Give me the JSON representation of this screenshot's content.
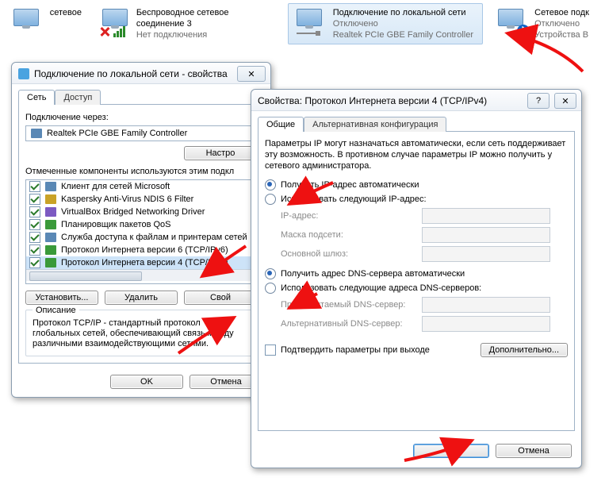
{
  "netbar": {
    "items": [
      {
        "title_suffix": "сетевое",
        "sub": ""
      },
      {
        "title": "Беспроводное сетевое соединение 3",
        "sub": "Нет подключения"
      },
      {
        "title": "Подключение по локальной сети",
        "sub1": "Отключено",
        "sub2": "Realtek PCIe GBE Family Controller"
      },
      {
        "title": "Сетевое подк",
        "sub1": "Отключено",
        "sub2": "Устройства B"
      }
    ]
  },
  "propsWin": {
    "title": "Подключение по локальной сети - свойства",
    "close": "✕",
    "tabs": {
      "net": "Сеть",
      "access": "Доступ"
    },
    "connect_via": "Подключение через:",
    "adapter": "Realtek PCIe GBE Family Controller",
    "configure": "Настро",
    "components_label": "Отмеченные компоненты используются этим подкл",
    "items": [
      "Клиент для сетей Microsoft",
      "Kaspersky Anti-Virus NDIS 6 Filter",
      "VirtualBox Bridged Networking Driver",
      "Планировщик пакетов QoS",
      "Служба доступа к файлам и принтерам сетей",
      "Протокол Интернета версии 6 (TCP/IPv6)",
      "Протокол Интернета версии 4 (TCP/IPv4)"
    ],
    "install": "Установить...",
    "remove": "Удалить",
    "props": "Свой",
    "desc_title": "Описание",
    "desc": "Протокол TCP/IP - стандартный протокол глобальных сетей, обеспечивающий связь между различными взаимодействующими сетями.",
    "ok": "OK",
    "cancel": "Отмена"
  },
  "ipWin": {
    "title": "Свойства: Протокол Интернета версии 4 (TCP/IPv4)",
    "help": "?",
    "close": "✕",
    "tabs": {
      "general": "Общие",
      "alt": "Альтернативная конфигурация"
    },
    "intro": "Параметры IP могут назначаться автоматически, если сеть поддерживает эту возможность. В противном случае параметры IP можно получить у сетевого администратора.",
    "auto_ip": "Получить IP-адрес автоматически",
    "manual_ip": "Использовать следующий IP-адрес:",
    "ip": "IP-адрес:",
    "mask": "Маска подсети:",
    "gw": "Основной шлюз:",
    "auto_dns": "Получить адрес DNS-сервера автоматически",
    "manual_dns": "Использовать следующие адреса DNS-серверов:",
    "dns1": "Предпочитаемый DNS-сервер:",
    "dns2": "Альтернативный DNS-сервер:",
    "confirm_exit": "Подтвердить параметры при выходе",
    "advanced": "Дополнительно...",
    "ok": "OK",
    "cancel": "Отмена"
  }
}
